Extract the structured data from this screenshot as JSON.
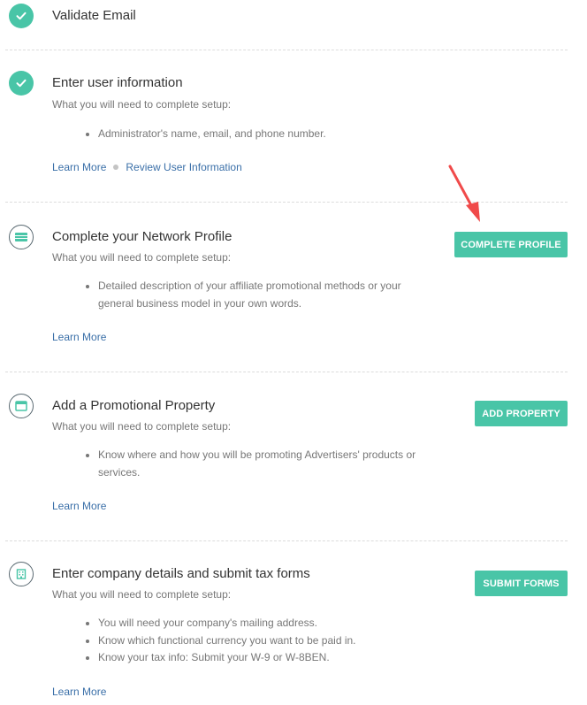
{
  "steps": [
    {
      "title": "Validate Email",
      "status": "complete",
      "icon": "check-icon"
    },
    {
      "title": "Enter user information",
      "status": "complete",
      "icon": "check-icon",
      "need_label": "What you will need to complete setup:",
      "requirements": [
        "Administrator's name, email, and phone number."
      ],
      "learn_more": "Learn More",
      "review_link": "Review User Information"
    },
    {
      "title": "Complete your Network Profile",
      "status": "pending",
      "icon": "profile-card-icon",
      "need_label": "What you will need to complete setup:",
      "requirements": [
        "Detailed description of your affiliate promotional methods or your general business model in your own words."
      ],
      "learn_more": "Learn More",
      "button": "COMPLETE PROFILE"
    },
    {
      "title": "Add a Promotional Property",
      "status": "pending",
      "icon": "browser-window-icon",
      "need_label": "What you will need to complete setup:",
      "requirements": [
        "Know where and how you will be promoting Advertisers' products or services."
      ],
      "learn_more": "Learn More",
      "button": "ADD PROPERTY"
    },
    {
      "title": "Enter company details and submit tax forms",
      "status": "pending",
      "icon": "building-icon",
      "need_label": "What you will need to complete setup:",
      "requirements": [
        "You will need your company's mailing address.",
        "Know which functional currency you want to be paid in.",
        "Know your tax info: Submit your W-9 or W-8BEN."
      ],
      "learn_more": "Learn More",
      "button": "SUBMIT FORMS"
    }
  ],
  "colors": {
    "accent": "#49c5a7",
    "link": "#3a6fa8",
    "annotation_arrow": "#f04a4a"
  }
}
